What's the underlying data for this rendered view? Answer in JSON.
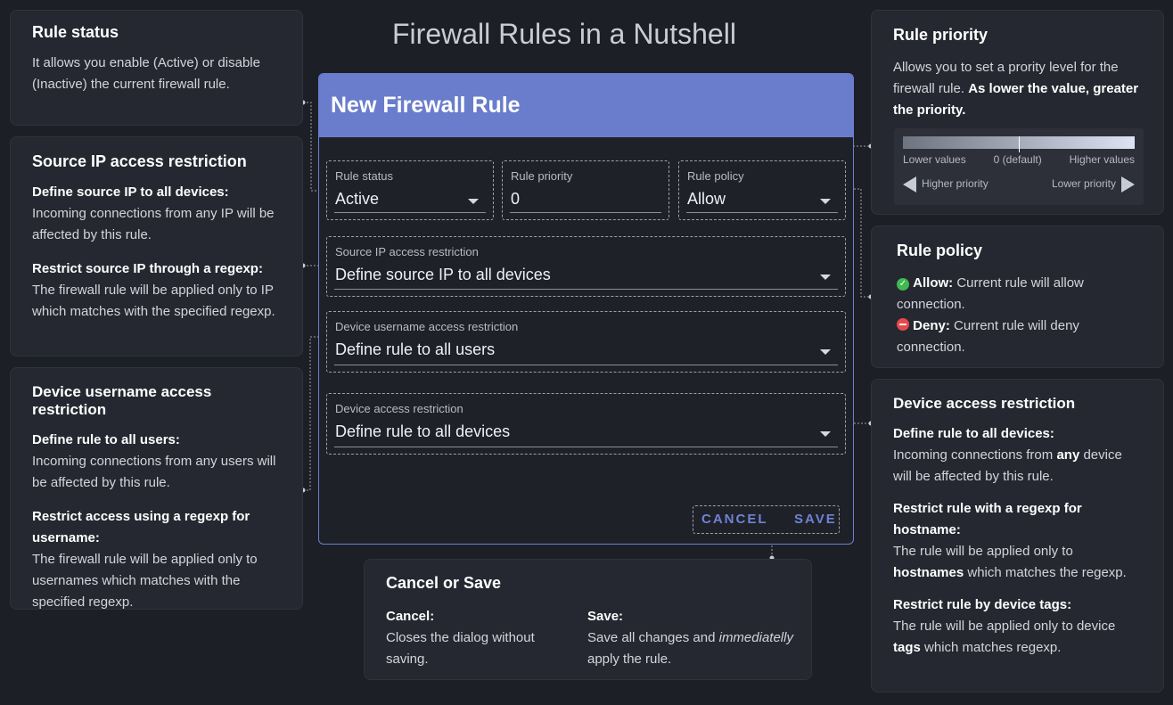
{
  "page_title": "Firewall Rules in a Nutshell",
  "dialog": {
    "title": "New Firewall Rule",
    "rule_status": {
      "label": "Rule status",
      "value": "Active"
    },
    "rule_priority": {
      "label": "Rule priority",
      "value": "0"
    },
    "rule_policy": {
      "label": "Rule policy",
      "value": "Allow"
    },
    "source_ip": {
      "label": "Source IP access restriction",
      "value": "Define source IP to all devices"
    },
    "username": {
      "label": "Device username access restriction",
      "value": "Define rule to all users"
    },
    "device": {
      "label": "Device access restriction",
      "value": "Define rule to all devices"
    },
    "cancel_label": "CANCEL",
    "save_label": "SAVE"
  },
  "panels": {
    "rule_status": {
      "title": "Rule status",
      "text": "It allows you enable (Active) or disable (Inactive) the current firewall rule."
    },
    "source_ip": {
      "title": "Source IP access restriction",
      "item1_title": "Define source IP to all devices:",
      "item1_text": "Incoming connections from any IP will be affected by this rule.",
      "item2_title": "Restrict source IP through a regexp:",
      "item2_text": "The firewall rule will be applied only to IP which matches with the specified regexp."
    },
    "username": {
      "title": "Device username access restriction",
      "item1_title": "Define rule to all users:",
      "item1_text": "Incoming connections from any users will be affected by this rule.",
      "item2_title": "Restrict access using a regexp for username:",
      "item2_text": "The firewall rule will be applied only to usernames which matches with the specified regexp."
    },
    "priority": {
      "title": "Rule priority",
      "text_a": "Allows you to set a prority level for the firewall rule.",
      "text_b": "As lower the value, greater the priority.",
      "scale_low": "Lower values",
      "scale_mid": "0 (default)",
      "scale_high": "Higher values",
      "higher_priority": "Higher priority",
      "lower_priority": "Lower priority"
    },
    "policy": {
      "title": "Rule policy",
      "allow_title": "Allow:",
      "allow_text": "Current rule will allow connection.",
      "deny_title": "Deny:",
      "deny_text": "Current rule will deny connection."
    },
    "device": {
      "title": "Device access restriction",
      "item1_title": "Define rule to all devices:",
      "item1_pre": "Incoming connections from",
      "item1_em": "any",
      "item1_post": "device will be affected by this rule.",
      "item2_title": "Restrict rule with a regexp for hostname:",
      "item2_pre": "The rule will be applied only to",
      "item2_em": "hostnames",
      "item2_post": "which matches the regexp.",
      "item3_title": "Restrict rule by device tags:",
      "item3_pre": "The rule will be applied only to device",
      "item3_em": "tags",
      "item3_post": "which matches regexp."
    },
    "cancel_save": {
      "title": "Cancel or Save",
      "cancel_title": "Cancel:",
      "cancel_text": "Closes the dialog without saving.",
      "save_title": "Save:",
      "save_text_pre": "Save all changes and",
      "save_text_em": "immediatelly",
      "save_text_post": "apply the rule."
    }
  },
  "colors": {
    "header": "#6a7dcc",
    "allow": "#3fb950",
    "deny": "#e5484d",
    "accent_button": "#6f82d4"
  },
  "icons": {
    "allow": "check-circle-icon",
    "deny": "minus-circle-icon",
    "dropdown": "chevron-down-icon"
  }
}
